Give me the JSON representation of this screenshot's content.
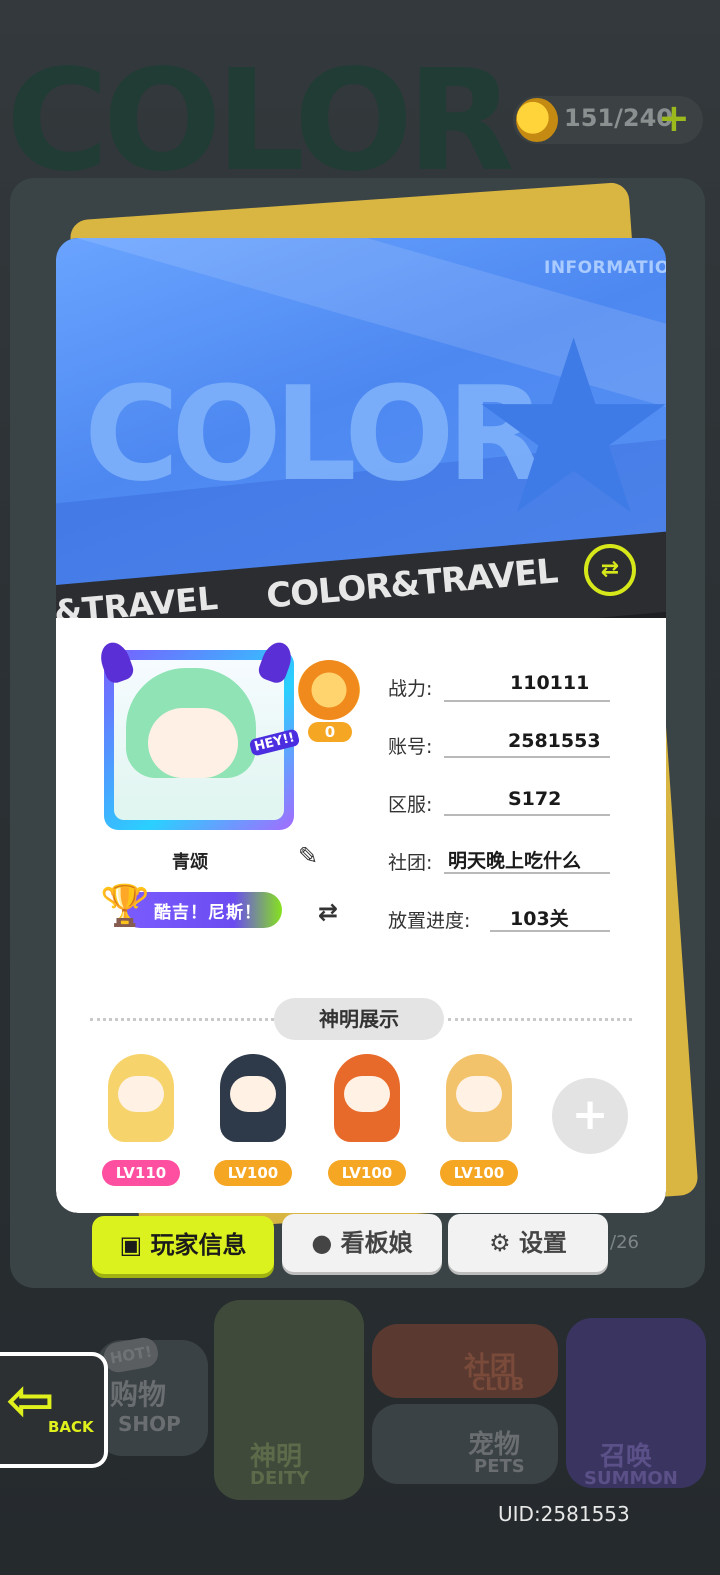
{
  "background": {
    "logo_word": "COLOR",
    "bottom_count": "/26"
  },
  "stamina": {
    "value": "151/240",
    "plus_icon": "plus-icon"
  },
  "card": {
    "banner_label": "INFORMATION",
    "banner_word": "COLOR",
    "tape_text": "COLOR&TRAVEL",
    "tape_text_left": "&TRAVEL"
  },
  "profile": {
    "avatar_tag": "HEY!!",
    "rank_number": "0",
    "nickname": "青颂",
    "title_badge": "酷吉！尼斯！"
  },
  "stats": [
    {
      "label": "战力:",
      "value": "110111"
    },
    {
      "label": "账号:",
      "value": "2581553"
    },
    {
      "label": "区服:",
      "value": "S172"
    },
    {
      "label": "社团:",
      "value": "明天晚上吃什么"
    },
    {
      "label": "放置进度:",
      "value": "103关"
    }
  ],
  "deity_section": {
    "title": "神明展示",
    "deities": [
      {
        "level": "LV110",
        "color": "#ff4fa0",
        "hair": "#f6d36b"
      },
      {
        "level": "LV100",
        "color": "#f5a623",
        "hair": "#2e3a4a"
      },
      {
        "level": "LV100",
        "color": "#f5a623",
        "hair": "#e86a2a"
      },
      {
        "level": "LV100",
        "color": "#f5a623",
        "hair": "#f3c36b"
      }
    ],
    "add_icon": "plus-icon"
  },
  "tabs": [
    {
      "label": "玩家信息",
      "icon": "id-card-icon"
    },
    {
      "label": "看板娘",
      "icon": "user-swap-icon"
    },
    {
      "label": "设置",
      "icon": "gear-icon"
    }
  ],
  "bottom_nav": {
    "hot": "HOT!",
    "shop": "购物",
    "shop_en": "SHOP",
    "deity": "神明",
    "deity_en": "DEITY",
    "club": "社团",
    "club_en": "CLUB",
    "pets": "宠物",
    "pets_en": "PETS",
    "summon": "召唤",
    "summon_en": "SUMMON"
  },
  "back": {
    "label": "BACK"
  },
  "uid": "UID:2581553",
  "colors": {
    "accent": "#dcf21e",
    "banner": "#5a95f5",
    "card_dark": "#1d1f22"
  }
}
